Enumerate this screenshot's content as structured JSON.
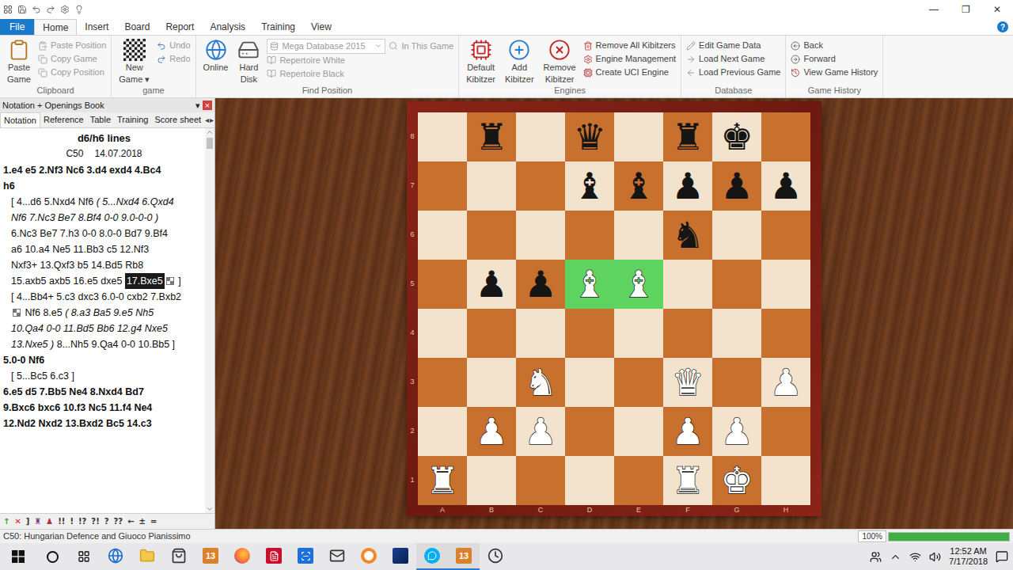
{
  "window": {
    "controls": [
      "—",
      "❐",
      "✕"
    ]
  },
  "ribbon": {
    "file_tab": "File",
    "tabs": [
      {
        "label": "Home",
        "selected": true
      },
      {
        "label": "Insert",
        "selected": false
      },
      {
        "label": "Board",
        "selected": false
      },
      {
        "label": "Report",
        "selected": false
      },
      {
        "label": "Analysis",
        "selected": false
      },
      {
        "label": "Training",
        "selected": false
      },
      {
        "label": "View",
        "selected": false
      }
    ],
    "help": "?",
    "groups": [
      {
        "label": "Clipboard",
        "large": [
          {
            "lines": [
              "Paste",
              "Game"
            ],
            "kind": "paste",
            "disabled": false
          }
        ],
        "small": [
          {
            "label": "Paste Position",
            "kind": "paste-position",
            "disabled": true
          },
          {
            "label": "Copy Game",
            "kind": "copy",
            "disabled": true
          },
          {
            "label": "Copy Position",
            "kind": "copy",
            "disabled": true
          }
        ]
      },
      {
        "label": "game",
        "large": [
          {
            "lines": [
              "New",
              "Game ▾"
            ],
            "kind": "board",
            "disabled": false
          }
        ],
        "small": [
          {
            "label": "Undo",
            "kind": "undo",
            "disabled": true
          },
          {
            "label": "Redo",
            "kind": "redo",
            "disabled": true
          }
        ]
      },
      {
        "label": "Find Position",
        "large": [
          {
            "lines": [
              "Online"
            ],
            "kind": "online",
            "disabled": false
          },
          {
            "lines": [
              "Hard",
              "Disk"
            ],
            "kind": "disk",
            "disabled": false
          }
        ],
        "dropdown": {
          "value": "Mega Database 2015",
          "disabled": true
        },
        "dropdown_side": {
          "label": "In This Game",
          "kind": "search",
          "disabled": true
        },
        "small": [
          {
            "label": "Repertoire White",
            "kind": "repertoire",
            "disabled": true
          },
          {
            "label": "Repertoire Black",
            "kind": "repertoire",
            "disabled": true
          }
        ]
      },
      {
        "label": "Engines",
        "large": [
          {
            "lines": [
              "Default",
              "Kibitzer"
            ],
            "kind": "kibitzer",
            "disabled": false
          },
          {
            "lines": [
              "Add",
              "Kibitzer"
            ],
            "kind": "add-kibitzer",
            "disabled": false
          },
          {
            "lines": [
              "Remove",
              "Kibitzer"
            ],
            "kind": "remove-kibitzer",
            "disabled": false
          }
        ],
        "small": [
          {
            "label": "Remove All Kibitzers",
            "kind": "trash",
            "disabled": false
          },
          {
            "label": "Engine Management",
            "kind": "settings",
            "disabled": false
          },
          {
            "label": "Create UCI Engine",
            "kind": "cpu",
            "disabled": false
          }
        ]
      },
      {
        "label": "Database",
        "large": [],
        "small": [
          {
            "label": "Edit Game Data",
            "kind": "edit",
            "disabled": false
          },
          {
            "label": "Load Next Game",
            "kind": "next",
            "disabled": false
          },
          {
            "label": "Load Previous Game",
            "kind": "prev",
            "disabled": false
          }
        ]
      },
      {
        "label": "Game History",
        "large": [],
        "small": [
          {
            "label": "Back",
            "kind": "back",
            "disabled": false
          },
          {
            "label": "Forward",
            "kind": "forward",
            "disabled": false
          },
          {
            "label": "View Game History",
            "kind": "history",
            "disabled": false
          }
        ]
      }
    ]
  },
  "notation_panel": {
    "title": "Notation + Openings Book",
    "menu": "▾",
    "close": "×",
    "tabs": [
      {
        "label": "Notation",
        "selected": true
      },
      {
        "label": "Reference",
        "selected": false
      },
      {
        "label": "Table",
        "selected": false
      },
      {
        "label": "Training",
        "selected": false
      },
      {
        "label": "Score sheet",
        "selected": false
      }
    ],
    "tab_arrows": [
      "◂",
      "▸"
    ],
    "game_title": "d6/h6 lines",
    "eco": "C50",
    "date": "14.07.2018",
    "lines": [
      {
        "indent": false,
        "segments": [
          {
            "text": "1.e4 e5 2.Nf3 Nc6 3.d4 exd4 4.Bc4",
            "style": "main"
          }
        ]
      },
      {
        "indent": false,
        "segments": [
          {
            "text": "h6",
            "style": "main"
          }
        ]
      },
      {
        "indent": true,
        "segments": [
          {
            "text": "[ 4...d6 5.Nxd4 Nf6 ",
            "style": "var"
          },
          {
            "text": "( 5...Nxd4 6.Qxd4",
            "style": "sub"
          }
        ]
      },
      {
        "indent": true,
        "segments": [
          {
            "text": "Nf6 7.Nc3 Be7 8.Bf4 0-0 9.0-0-0 )",
            "style": "sub"
          }
        ]
      },
      {
        "indent": true,
        "segments": [
          {
            "text": "6.Nc3 Be7 7.h3 0-0 8.0-0 Bd7 9.Bf4",
            "style": "var"
          }
        ]
      },
      {
        "indent": true,
        "segments": [
          {
            "text": "a6 10.a4 Ne5 11.Bb3 c5 12.Nf3",
            "style": "var"
          }
        ]
      },
      {
        "indent": true,
        "segments": [
          {
            "text": "Nxf3+ 13.Qxf3 b5 14.Bd5 Rb8",
            "style": "var"
          }
        ]
      },
      {
        "indent": true,
        "segments": [
          {
            "text": "15.axb5 axb5 16.e5 dxe5 ",
            "style": "var"
          },
          {
            "text": "17.Bxe5",
            "style": "current"
          },
          {
            "text": "",
            "style": "diagram"
          },
          {
            "text": " ]",
            "style": "var"
          }
        ]
      },
      {
        "indent": true,
        "segments": [
          {
            "text": "[ 4...Bb4+ 5.c3 dxc3 6.0-0 cxb2 7.Bxb2",
            "style": "var"
          }
        ]
      },
      {
        "indent": true,
        "segments": [
          {
            "text": "",
            "style": "diagram"
          },
          {
            "text": " Nf6 8.e5 ",
            "style": "var"
          },
          {
            "text": "( 8.a3 Ba5 9.e5 Nh5",
            "style": "sub"
          }
        ]
      },
      {
        "indent": true,
        "segments": [
          {
            "text": "10.Qa4 0-0 11.Bd5 Bb6 12.g4 Nxe5",
            "style": "sub"
          }
        ]
      },
      {
        "indent": true,
        "segments": [
          {
            "text": "13.Nxe5 )",
            "style": "sub"
          },
          {
            "text": " 8...Nh5 9.Qa4 0-0 10.Bb5 ]",
            "style": "var"
          }
        ]
      },
      {
        "indent": false,
        "segments": [
          {
            "text": "5.0-0 Nf6",
            "style": "main"
          }
        ]
      },
      {
        "indent": true,
        "segments": [
          {
            "text": "[ 5...Bc5 6.c3 ]",
            "style": "var"
          }
        ]
      },
      {
        "indent": false,
        "segments": [
          {
            "text": "6.e5 d5 7.Bb5 Ne4 8.Nxd4 Bd7",
            "style": "main"
          }
        ]
      },
      {
        "indent": false,
        "segments": [
          {
            "text": "9.Bxc6 bxc6 10.f3 Nc5 11.f4 Ne4",
            "style": "main"
          }
        ]
      },
      {
        "indent": false,
        "segments": [
          {
            "text": "12.Nd2 Nxd2 13.Bxd2 Bc5 14.c3",
            "style": "main"
          }
        ]
      }
    ],
    "toolbar": [
      {
        "text": "↑",
        "color": "#2e9e2e"
      },
      {
        "text": "✕",
        "color": "#d02020"
      },
      {
        "text": "]",
        "color": "#333333"
      },
      {
        "text": "♜",
        "color": "#7a3b8a"
      },
      {
        "text": "♟",
        "color": "#b03030"
      },
      {
        "text": "!!",
        "color": "#333333"
      },
      {
        "text": "!",
        "color": "#333333"
      },
      {
        "text": "!?",
        "color": "#333333"
      },
      {
        "text": "?!",
        "color": "#333333"
      },
      {
        "text": "?",
        "color": "#333333"
      },
      {
        "text": "??",
        "color": "#333333"
      },
      {
        "text": "←",
        "color": "#333333"
      },
      {
        "text": "±",
        "color": "#333333"
      },
      {
        "text": "=",
        "color": "#333333"
      }
    ]
  },
  "board": {
    "files": [
      "A",
      "B",
      "C",
      "D",
      "E",
      "F",
      "G",
      "H"
    ],
    "ranks": [
      "8",
      "7",
      "6",
      "5",
      "4",
      "3",
      "2",
      "1"
    ],
    "pieces": [
      {
        "file": "B",
        "rank": "8",
        "glyph": "♜",
        "side": "black",
        "highlighted": false
      },
      {
        "file": "D",
        "rank": "8",
        "glyph": "♛",
        "side": "black",
        "highlighted": false
      },
      {
        "file": "F",
        "rank": "8",
        "glyph": "♜",
        "side": "black",
        "highlighted": false
      },
      {
        "file": "G",
        "rank": "8",
        "glyph": "♚",
        "side": "black",
        "highlighted": false
      },
      {
        "file": "D",
        "rank": "7",
        "glyph": "♝",
        "side": "black",
        "highlighted": false
      },
      {
        "file": "E",
        "rank": "7",
        "glyph": "♝",
        "side": "black",
        "highlighted": false
      },
      {
        "file": "F",
        "rank": "7",
        "glyph": "♟",
        "side": "black",
        "highlighted": false
      },
      {
        "file": "G",
        "rank": "7",
        "glyph": "♟",
        "side": "black",
        "highlighted": false
      },
      {
        "file": "H",
        "rank": "7",
        "glyph": "♟",
        "side": "black",
        "highlighted": false
      },
      {
        "file": "F",
        "rank": "6",
        "glyph": "♞",
        "side": "black",
        "highlighted": false
      },
      {
        "file": "B",
        "rank": "5",
        "glyph": "♟",
        "side": "black",
        "highlighted": false
      },
      {
        "file": "C",
        "rank": "5",
        "glyph": "♟",
        "side": "black",
        "highlighted": false
      },
      {
        "file": "D",
        "rank": "5",
        "glyph": "♝",
        "side": "white",
        "highlighted": true
      },
      {
        "file": "E",
        "rank": "5",
        "glyph": "♝",
        "side": "white",
        "highlighted": true
      },
      {
        "file": "C",
        "rank": "3",
        "glyph": "♞",
        "side": "white",
        "highlighted": false
      },
      {
        "file": "F",
        "rank": "3",
        "glyph": "♛",
        "side": "white",
        "highlighted": false
      },
      {
        "file": "H",
        "rank": "3",
        "glyph": "♟",
        "side": "white",
        "highlighted": false
      },
      {
        "file": "B",
        "rank": "2",
        "glyph": "♟",
        "side": "white",
        "highlighted": false
      },
      {
        "file": "C",
        "rank": "2",
        "glyph": "♟",
        "side": "white",
        "highlighted": false
      },
      {
        "file": "F",
        "rank": "2",
        "glyph": "♟",
        "side": "white",
        "highlighted": false
      },
      {
        "file": "G",
        "rank": "2",
        "glyph": "♟",
        "side": "white",
        "highlighted": false
      },
      {
        "file": "A",
        "rank": "1",
        "glyph": "♜",
        "side": "white",
        "highlighted": false
      },
      {
        "file": "F",
        "rank": "1",
        "glyph": "♜",
        "side": "white",
        "highlighted": false
      },
      {
        "file": "G",
        "rank": "1",
        "glyph": "♚",
        "side": "white",
        "highlighted": false
      }
    ]
  },
  "status_bar": {
    "text": "C50: Hungarian Defence and Giuoco Pianissimo",
    "zoom": "100%",
    "level": 1
  },
  "taskbar": {
    "apps": [
      {
        "kind": "edge",
        "text": "",
        "active": false
      },
      {
        "kind": "explorer",
        "text": "",
        "active": false
      },
      {
        "kind": "store",
        "text": "",
        "active": false
      },
      {
        "kind": "chessbase",
        "text": "13",
        "active": false
      },
      {
        "kind": "firefox",
        "text": "",
        "active": false
      },
      {
        "kind": "acrobat",
        "text": "",
        "active": false
      },
      {
        "kind": "scanner",
        "text": "",
        "active": false
      },
      {
        "kind": "mail",
        "text": "",
        "active": false
      },
      {
        "kind": "orange",
        "text": "",
        "active": false
      },
      {
        "kind": "fritz",
        "text": "",
        "active": false
      },
      {
        "kind": "skype",
        "text": "",
        "active": true
      },
      {
        "kind": "chessbase",
        "text": "13",
        "active": true
      },
      {
        "kind": "clock",
        "text": "",
        "active": false
      }
    ],
    "time": "12:52 AM",
    "date": "7/17/2018"
  }
}
